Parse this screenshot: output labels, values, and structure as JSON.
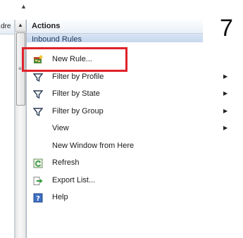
{
  "left_column": {
    "header_text": "dre"
  },
  "actions": {
    "title": "Actions",
    "section": "Inbound Rules",
    "items": [
      {
        "label": "New Rule...",
        "icon": "new-rule-icon",
        "submenu": false
      },
      {
        "label": "Filter by Profile",
        "icon": "filter-icon",
        "submenu": true
      },
      {
        "label": "Filter by State",
        "icon": "filter-icon",
        "submenu": true
      },
      {
        "label": "Filter by Group",
        "icon": "filter-icon",
        "submenu": true
      },
      {
        "label": "View",
        "icon": "",
        "submenu": true
      },
      {
        "label": "New Window from Here",
        "icon": "",
        "submenu": false
      },
      {
        "label": "Refresh",
        "icon": "refresh-icon",
        "submenu": false
      },
      {
        "label": "Export List...",
        "icon": "export-icon",
        "submenu": false
      },
      {
        "label": "Help",
        "icon": "help-icon",
        "submenu": false
      }
    ]
  },
  "annotation": {
    "step_number": "7",
    "highlight_color": "#e0212a"
  }
}
